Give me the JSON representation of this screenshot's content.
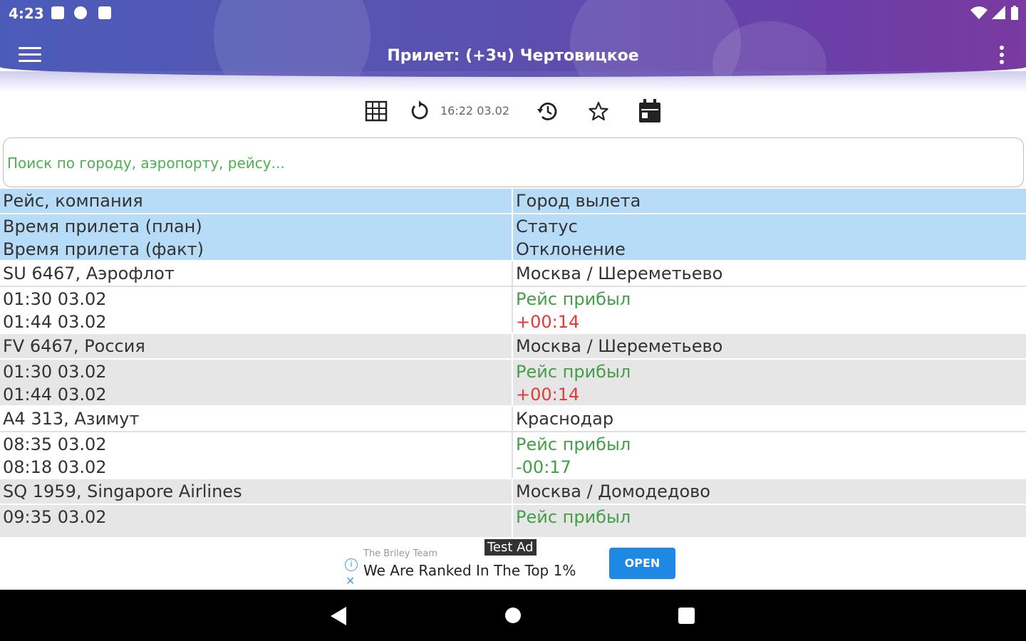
{
  "status_bar": {
    "time": "4:23"
  },
  "app_bar": {
    "title": "Прилет: (+3ч) Чертовицкое"
  },
  "toolbar": {
    "updated_time": "16:22 03.02"
  },
  "search": {
    "placeholder": "Поиск по городу, аэропорту, рейсу..."
  },
  "table": {
    "header": {
      "left_line1": "Рейс, компания",
      "right_line1": "Город вылета",
      "left_line2": "Время прилета (план)",
      "left_line3": "Время прилета (факт)",
      "right_line2": "Статус",
      "right_line3": "Отклонение"
    },
    "rows": [
      {
        "flight": "SU 6467, Аэрофлот",
        "city": "Москва / Шереметьево",
        "plan": "01:30 03.02",
        "fact": "01:44 03.02",
        "status": "Рейс прибыл",
        "deviation": "+00:14"
      },
      {
        "flight": "FV 6467, Россия",
        "city": "Москва / Шереметьево",
        "plan": "01:30 03.02",
        "fact": "01:44 03.02",
        "status": "Рейс прибыл",
        "deviation": "+00:14"
      },
      {
        "flight": "A4 313, Азимут",
        "city": "Краснодар",
        "plan": "08:35 03.02",
        "fact": "08:18 03.02",
        "status": "Рейс прибыл",
        "deviation": "-00:17"
      },
      {
        "flight": "SQ 1959, Singapore Airlines",
        "city": "Москва / Домодедово",
        "plan": "09:35 03.02",
        "fact": "",
        "status": "Рейс прибыл",
        "deviation": ""
      }
    ]
  },
  "ad": {
    "advertiser": "The Briley Team",
    "headline": "We Are Ranked In The Top 1%",
    "badge": "Test Ad",
    "cta": "OPEN"
  },
  "colors": {
    "header_bg": "#b7dcf7",
    "alt_row_bg": "#e6e6e6",
    "status_green": "#43a047",
    "delay_red": "#e53935"
  }
}
